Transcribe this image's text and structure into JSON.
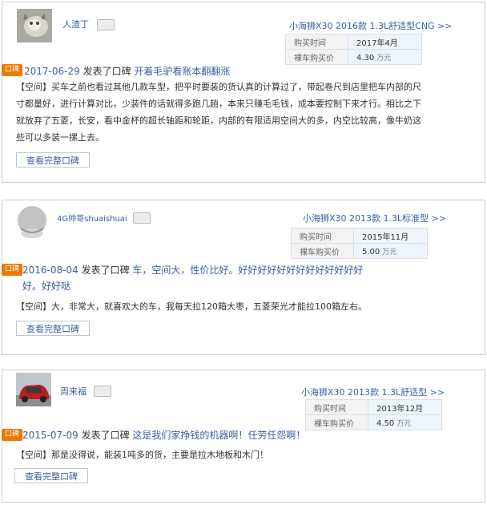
{
  "reviews": [
    {
      "username": "人渣丁",
      "model": "小海狮X30 2016款 1.3L舒适型CNG >>",
      "purchase_time_label": "购买时间",
      "purchase_time": "2017年4月",
      "price_label": "裸车购买价",
      "price": "4.30",
      "price_unit": "万元",
      "tag": "口碑",
      "date": "2017-06-29",
      "action": "发表了口碑",
      "title": "开着毛驴看账本翻翻涨",
      "body_lines": [
        "【空间】买车之前也看过其他几款车型，把平时要装的货认真的计算过了，带起卷尺到店里把车内部的尺",
        "寸都量好，进行计算对比，少装件的话就得多跑几趟，本来只赚毛毛钱，成本要控制下来才行。相比之下",
        "就放弃了五菱，长安，看中金杯的超长轴距和轮距，内部的有限适用空间大的多，内空比较高，像牛奶这",
        "些可以多装一摞上去。"
      ],
      "button": "查看完整口碑"
    },
    {
      "username": "4G帅哥shuaishuai",
      "model": "小海狮X30 2013款 1.3L标准型 >>",
      "purchase_time_label": "购买时间",
      "purchase_time": "2015年11月",
      "price_label": "裸车购买价",
      "price": "5.00",
      "price_unit": "万元",
      "tag": "口碑",
      "date": "2016-08-04",
      "action": "发表了口碑",
      "title_lines": [
        "车，空间大，性价比好。好好好好好好好好好好好好好",
        "好。好好哒"
      ],
      "body_lines": [
        "【空间】大，非常大，就喜欢大的车，我每天拉120箱大枣，五菱荣光才能拉100箱左右。"
      ],
      "button": "查看完整口碑"
    },
    {
      "username": "周来福",
      "model": "小海狮X30 2013款 1.3L舒适型 >>",
      "purchase_time_label": "购买时间",
      "purchase_time": "2013年12月",
      "price_label": "裸车购买价",
      "price": "4.50",
      "price_unit": "万元",
      "tag": "口碑",
      "date": "2015-07-09",
      "action": "发表了口碑",
      "title": "这是我们家挣钱的机器啊！任劳任怨啊！",
      "body_lines": [
        "【空间】那是没得说，能装1吨多的货，主要是拉木地板和木门！"
      ],
      "button": "查看完整口碑"
    }
  ]
}
